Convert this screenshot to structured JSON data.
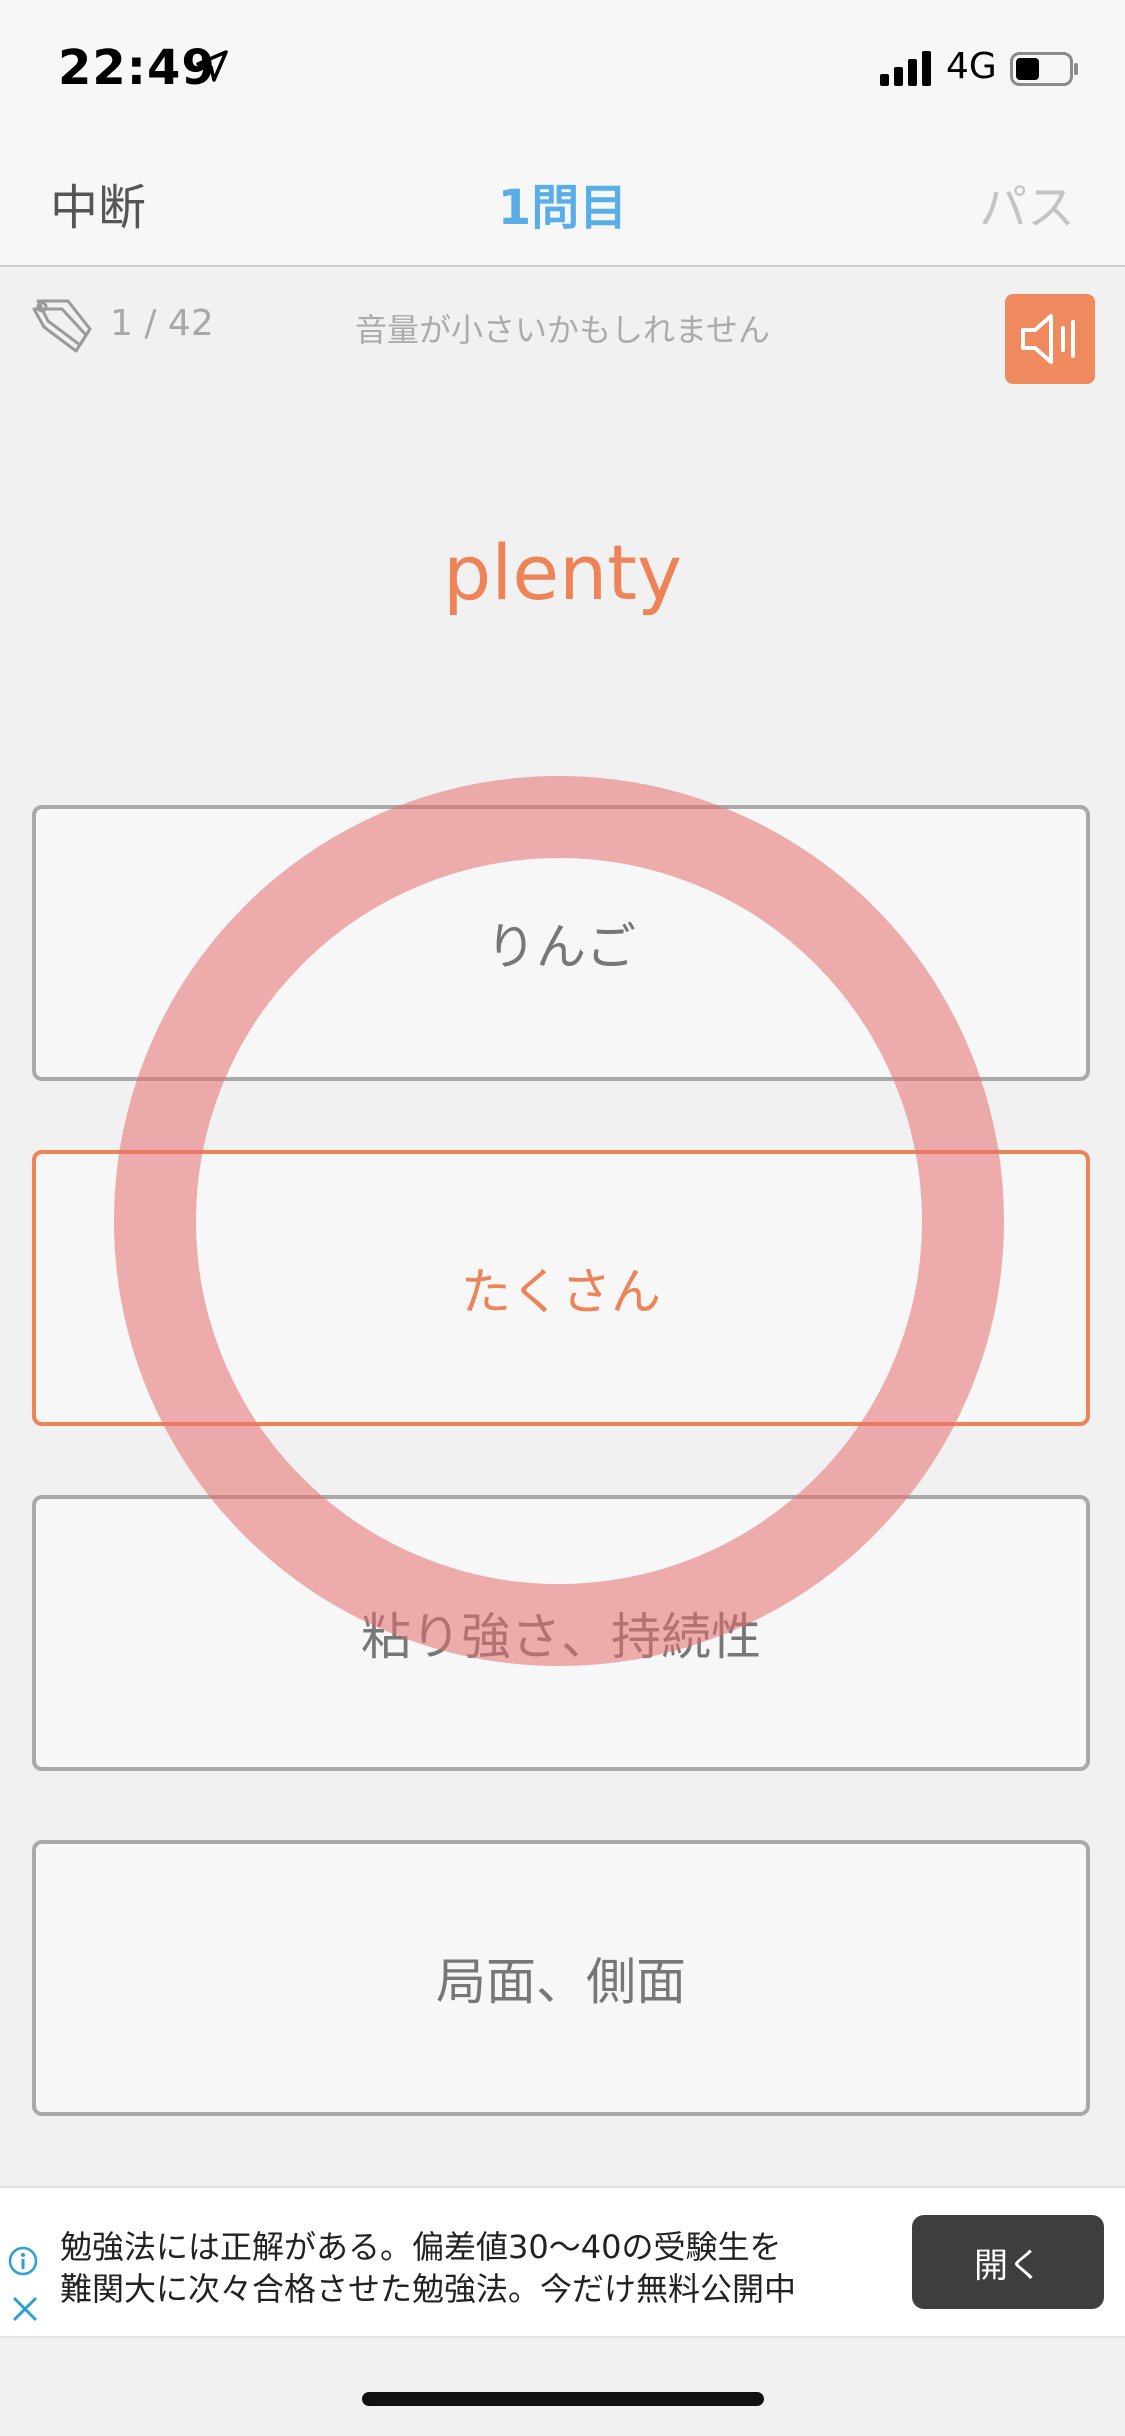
{
  "status_bar": {
    "time": "22:49",
    "network": "4G",
    "battery_level": 0.45
  },
  "nav": {
    "left_label": "中断",
    "title": "1問目",
    "right_label": "パス"
  },
  "quiz": {
    "counter": "1 / 42",
    "volume_message": "音量が小さいかもしれません",
    "word": "plenty",
    "options": [
      "りんご",
      "たくさん",
      "粘り強さ、持続性",
      "局面、側面"
    ],
    "correct_index": 1
  },
  "ad": {
    "line1": "勉強法には正解がある。偏差値30〜40の受験生を",
    "line2": "難関大に次々合格させた勉強法。今だけ無料公開中",
    "button_label": "開く"
  },
  "colors": {
    "accent": "#ef8358",
    "title_blue": "#5aaee8",
    "correct_ring": "#e56e6e"
  }
}
